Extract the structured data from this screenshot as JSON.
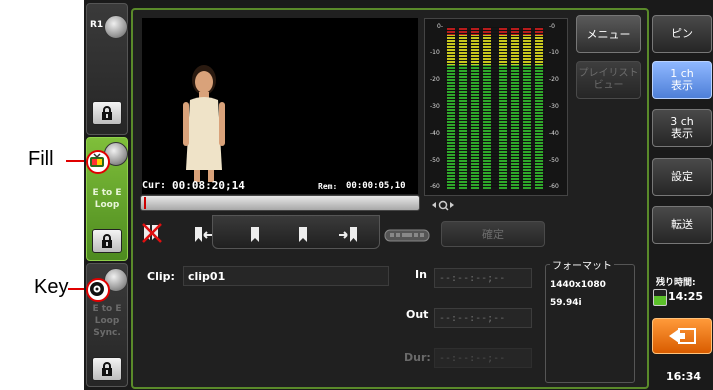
{
  "annotations": {
    "fill": "Fill",
    "key": "Key"
  },
  "channels": {
    "r1": {
      "label": "R1"
    },
    "fill": {
      "mode_line1": "E to E",
      "mode_line2": "Loop"
    },
    "key": {
      "mode_line1": "E to E",
      "mode_line2": "Loop",
      "mode_line3": "Sync."
    }
  },
  "player": {
    "cur_label": "Cur:",
    "cur_value": "00:08:20;14",
    "rem_label": "Rem:",
    "rem_value": "00:00:05,10",
    "scrub_position": 0.0
  },
  "meter": {
    "ticks_left": [
      "0-",
      "-10",
      "-20",
      "-30",
      "-40",
      "-50",
      "-60"
    ],
    "ticks_right": [
      "-0",
      "-10",
      "-20",
      "-30",
      "-40",
      "-50",
      "-60"
    ],
    "zoom_icon": "zoom-icon"
  },
  "buttons": {
    "menu": "メニュー",
    "playlist_line1": "プレイリスト",
    "playlist_line2": "ビュー",
    "confirm": "確定",
    "pin": "ピン",
    "ch1_line1": "1 ch",
    "ch1_line2": "表示",
    "ch3_line1": "3 ch",
    "ch3_line2": "表示",
    "settings": "設定",
    "transfer": "転送"
  },
  "clip": {
    "clip_label": "Clip:",
    "clip_value": "clip01",
    "in_label": "In",
    "in_value": "--:--:--;--",
    "out_label": "Out",
    "out_value": "--:--:--;--",
    "dur_label": "Dur:",
    "dur_value": "--:--:--;--"
  },
  "format": {
    "title": "フォーマット",
    "resolution": "1440x1080",
    "rate": "59.94i"
  },
  "status": {
    "remaining_label": "残り時間:",
    "remaining_value": "14:25",
    "clock": "16:34"
  },
  "colors": {
    "accent_green": "#7fbf3a",
    "selected_blue": "#5b8be0",
    "back_orange": "#e86a00"
  }
}
